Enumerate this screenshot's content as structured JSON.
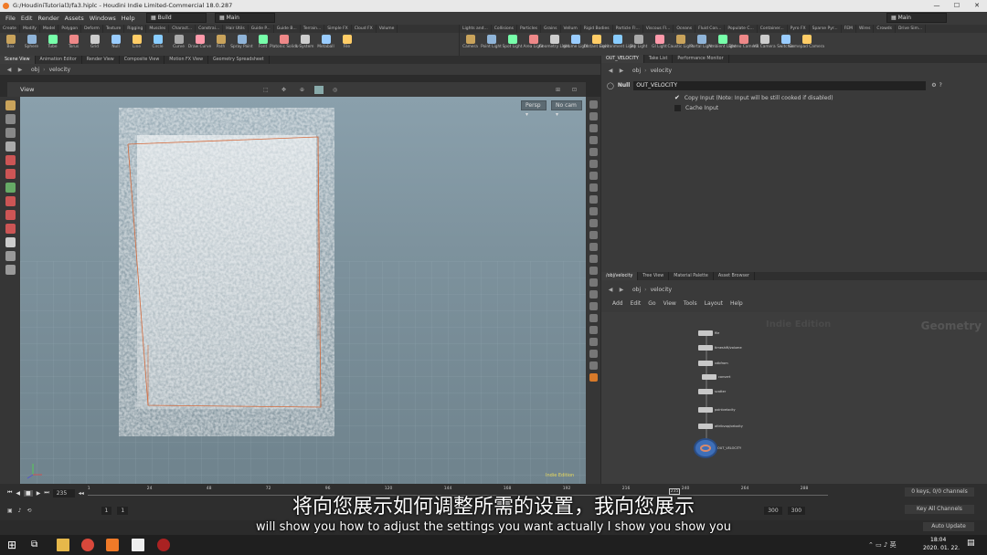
{
  "window": {
    "title": "G:/HoudiniTutorial3/fa3.hiplc - Houdini Indie Limited-Commercial 18.0.287",
    "controls": [
      "—",
      "☐",
      "✕"
    ]
  },
  "menu": [
    "File",
    "Edit",
    "Render",
    "Assets",
    "Windows",
    "Help"
  ],
  "desktop_menu": "Build",
  "desktop_main": "Main",
  "desktop_main_right": "Main",
  "shelf_left_tabs": [
    "Create",
    "Modify",
    "Model",
    "Polygon",
    "Deform",
    "Texture",
    "Rigging",
    "Muscles",
    "Charact...",
    "Constrai...",
    "Hair Utils",
    "Guide P...",
    "Guide B...",
    "Terrain...",
    "Simple FX",
    "Cloud FX",
    "Volume"
  ],
  "shelf_left_tools": [
    "Box",
    "Sphere",
    "Tube",
    "Torus",
    "Grid",
    "Null",
    "Line",
    "Circle",
    "Curve",
    "Draw Curve",
    "Path",
    "Spray Paint",
    "Font",
    "Platonic Solids",
    "L-System",
    "Metaball",
    "File"
  ],
  "shelf_right_tabs": [
    "Lights and...",
    "Collisions",
    "Particles",
    "Grains",
    "Vellum",
    "Rigid Bodies",
    "Particle Fl...",
    "Viscous Fl...",
    "Oceans",
    "Fluid Con...",
    "Populate C...",
    "Container...",
    "Pyro FX",
    "Sparse Pyr...",
    "FEM",
    "Wires",
    "Crowds",
    "Drive Sim..."
  ],
  "shelf_right_tools": [
    "Camera",
    "Point Light",
    "Spot Light",
    "Area Light",
    "Geometry Light",
    "Volume Light",
    "Distant Light",
    "Environment Light",
    "Sky Light",
    "GI Light",
    "Caustic Light",
    "Portal Light",
    "Ambient Light",
    "Stereo Camera",
    "VR Camera",
    "Switcher",
    "Gamepad Camera"
  ],
  "left_panel_tabs": [
    "Scene View",
    "Animation Editor",
    "Render View",
    "Composite View",
    "Motion FX View",
    "Geometry Spreadsheet"
  ],
  "left_path": {
    "obj": "obj",
    "node": "velocity"
  },
  "viewport": {
    "title": "View",
    "persp": "Persp ▾",
    "cam": "No cam ▾",
    "indie_mark": "Indie Edition"
  },
  "param_tabs": [
    "OUT_VELOCITY",
    "Take List",
    "Performance Monitor"
  ],
  "param_path": {
    "obj": "obj",
    "node": "velocity"
  },
  "param": {
    "type": "Null",
    "name": "OUT_VELOCITY",
    "copy_input": "Copy Input (Note: Input will be still cooked if disabled)",
    "cache_input": "Cache Input",
    "copy_checked": true,
    "cache_checked": false
  },
  "net_tabs": [
    "/obj/velocity",
    "Tree View",
    "Material Palette",
    "Asset Browser"
  ],
  "net_path": {
    "obj": "obj",
    "node": "velocity"
  },
  "net_menu": [
    "Add",
    "Edit",
    "Go",
    "View",
    "Tools",
    "Layout",
    "Help"
  ],
  "net_watermark": "Indie Edition",
  "net_context": "Geometry",
  "nodes": [
    "file",
    "timeshift/volume",
    "vdbfrom",
    "convert",
    "scatter",
    "pointvelocity",
    "attribvop/velocity",
    "OUT_VELOCITY"
  ],
  "timeline": {
    "current_frame": "235",
    "start": "1",
    "start2": "1",
    "end": "300",
    "end2": "300",
    "ticks": [
      "1",
      "24",
      "48",
      "72",
      "96",
      "120",
      "144",
      "168",
      "192",
      "216",
      "240",
      "264",
      "288"
    ],
    "keys": "0 keys, 0/0 channels",
    "key_all": "Key All Channels",
    "auto_update": "Auto Update"
  },
  "subtitles": {
    "zh": "将向您展示如何调整所需的设置，我向您展示",
    "en": "will show you how to adjust the settings you want actually I show you show you"
  },
  "taskbar": {
    "time": "18:04",
    "date": "2020. 01. 22."
  }
}
